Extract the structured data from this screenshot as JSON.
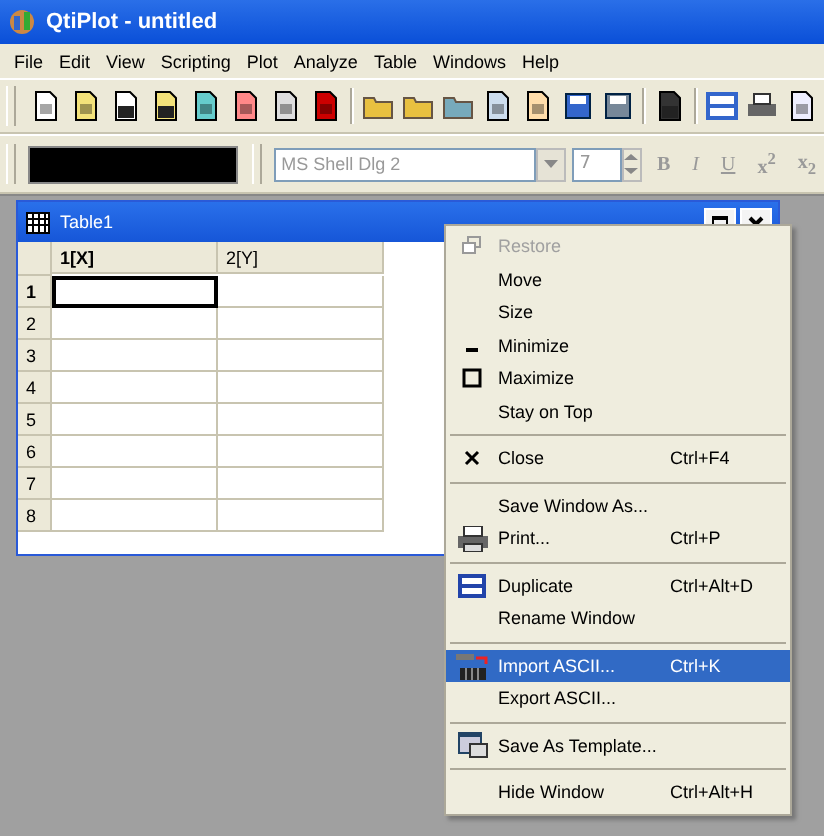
{
  "window": {
    "title": "QtiPlot - untitled"
  },
  "menu_bar": [
    "File",
    "Edit",
    "View",
    "Scripting",
    "Plot",
    "Analyze",
    "Table",
    "Windows",
    "Help"
  ],
  "format_toolbar": {
    "font": "MS Shell Dlg 2",
    "font_disabled": true,
    "size": "7",
    "buttons": [
      "B",
      "I",
      "U",
      "x$^{2}$",
      "x$_{2}$"
    ]
  },
  "table_window": {
    "title": "Table1",
    "columns": [
      "1[X]",
      "2[Y]"
    ],
    "rows": [
      {
        "label": "1",
        "current": true
      },
      {
        "label": "2",
        "current": false
      },
      {
        "label": "3",
        "current": false
      },
      {
        "label": "4",
        "current": false
      },
      {
        "label": "5",
        "current": false
      },
      {
        "label": "6",
        "current": false
      },
      {
        "label": "7",
        "current": false
      },
      {
        "label": "8",
        "current": false
      }
    ]
  },
  "context_menu": [
    {
      "kind": "item",
      "label": "Restore",
      "disabled": true,
      "selected": false
    },
    {
      "kind": "item",
      "label": "Move",
      "disabled": false,
      "selected": false
    },
    {
      "kind": "item",
      "label": "Size",
      "disabled": false,
      "selected": false
    },
    {
      "kind": "item",
      "label": "Minimize",
      "disabled": false,
      "selected": false
    },
    {
      "kind": "item",
      "label": "Maximize",
      "disabled": false,
      "selected": false
    },
    {
      "kind": "item",
      "label": "Stay on Top",
      "disabled": false,
      "selected": false
    },
    {
      "kind": "separator"
    },
    {
      "kind": "item",
      "label": "Close",
      "shortcut": "Ctrl+F4",
      "disabled": false,
      "selected": false
    },
    {
      "kind": "separator"
    },
    {
      "kind": "item",
      "label": "Save Window As...",
      "disabled": false,
      "selected": false
    },
    {
      "kind": "item",
      "label": "Print...",
      "shortcut": "Ctrl+P",
      "disabled": false,
      "selected": false
    },
    {
      "kind": "separator"
    },
    {
      "kind": "item",
      "label": "Duplicate",
      "shortcut": "Ctrl+Alt+D",
      "disabled": false,
      "selected": false
    },
    {
      "kind": "item",
      "label": "Rename Window",
      "disabled": false,
      "selected": false
    },
    {
      "kind": "separator"
    },
    {
      "kind": "item",
      "label": "Import ASCII...",
      "shortcut": "Ctrl+K",
      "disabled": false,
      "selected": true
    },
    {
      "kind": "item",
      "label": "Export ASCII...",
      "disabled": false,
      "selected": false
    },
    {
      "kind": "separator"
    },
    {
      "kind": "item",
      "label": "Save As Template...",
      "disabled": false,
      "selected": false
    },
    {
      "kind": "separator"
    },
    {
      "kind": "item",
      "label": "Hide Window",
      "shortcut": "Ctrl+Alt+H",
      "disabled": false,
      "selected": false
    }
  ]
}
